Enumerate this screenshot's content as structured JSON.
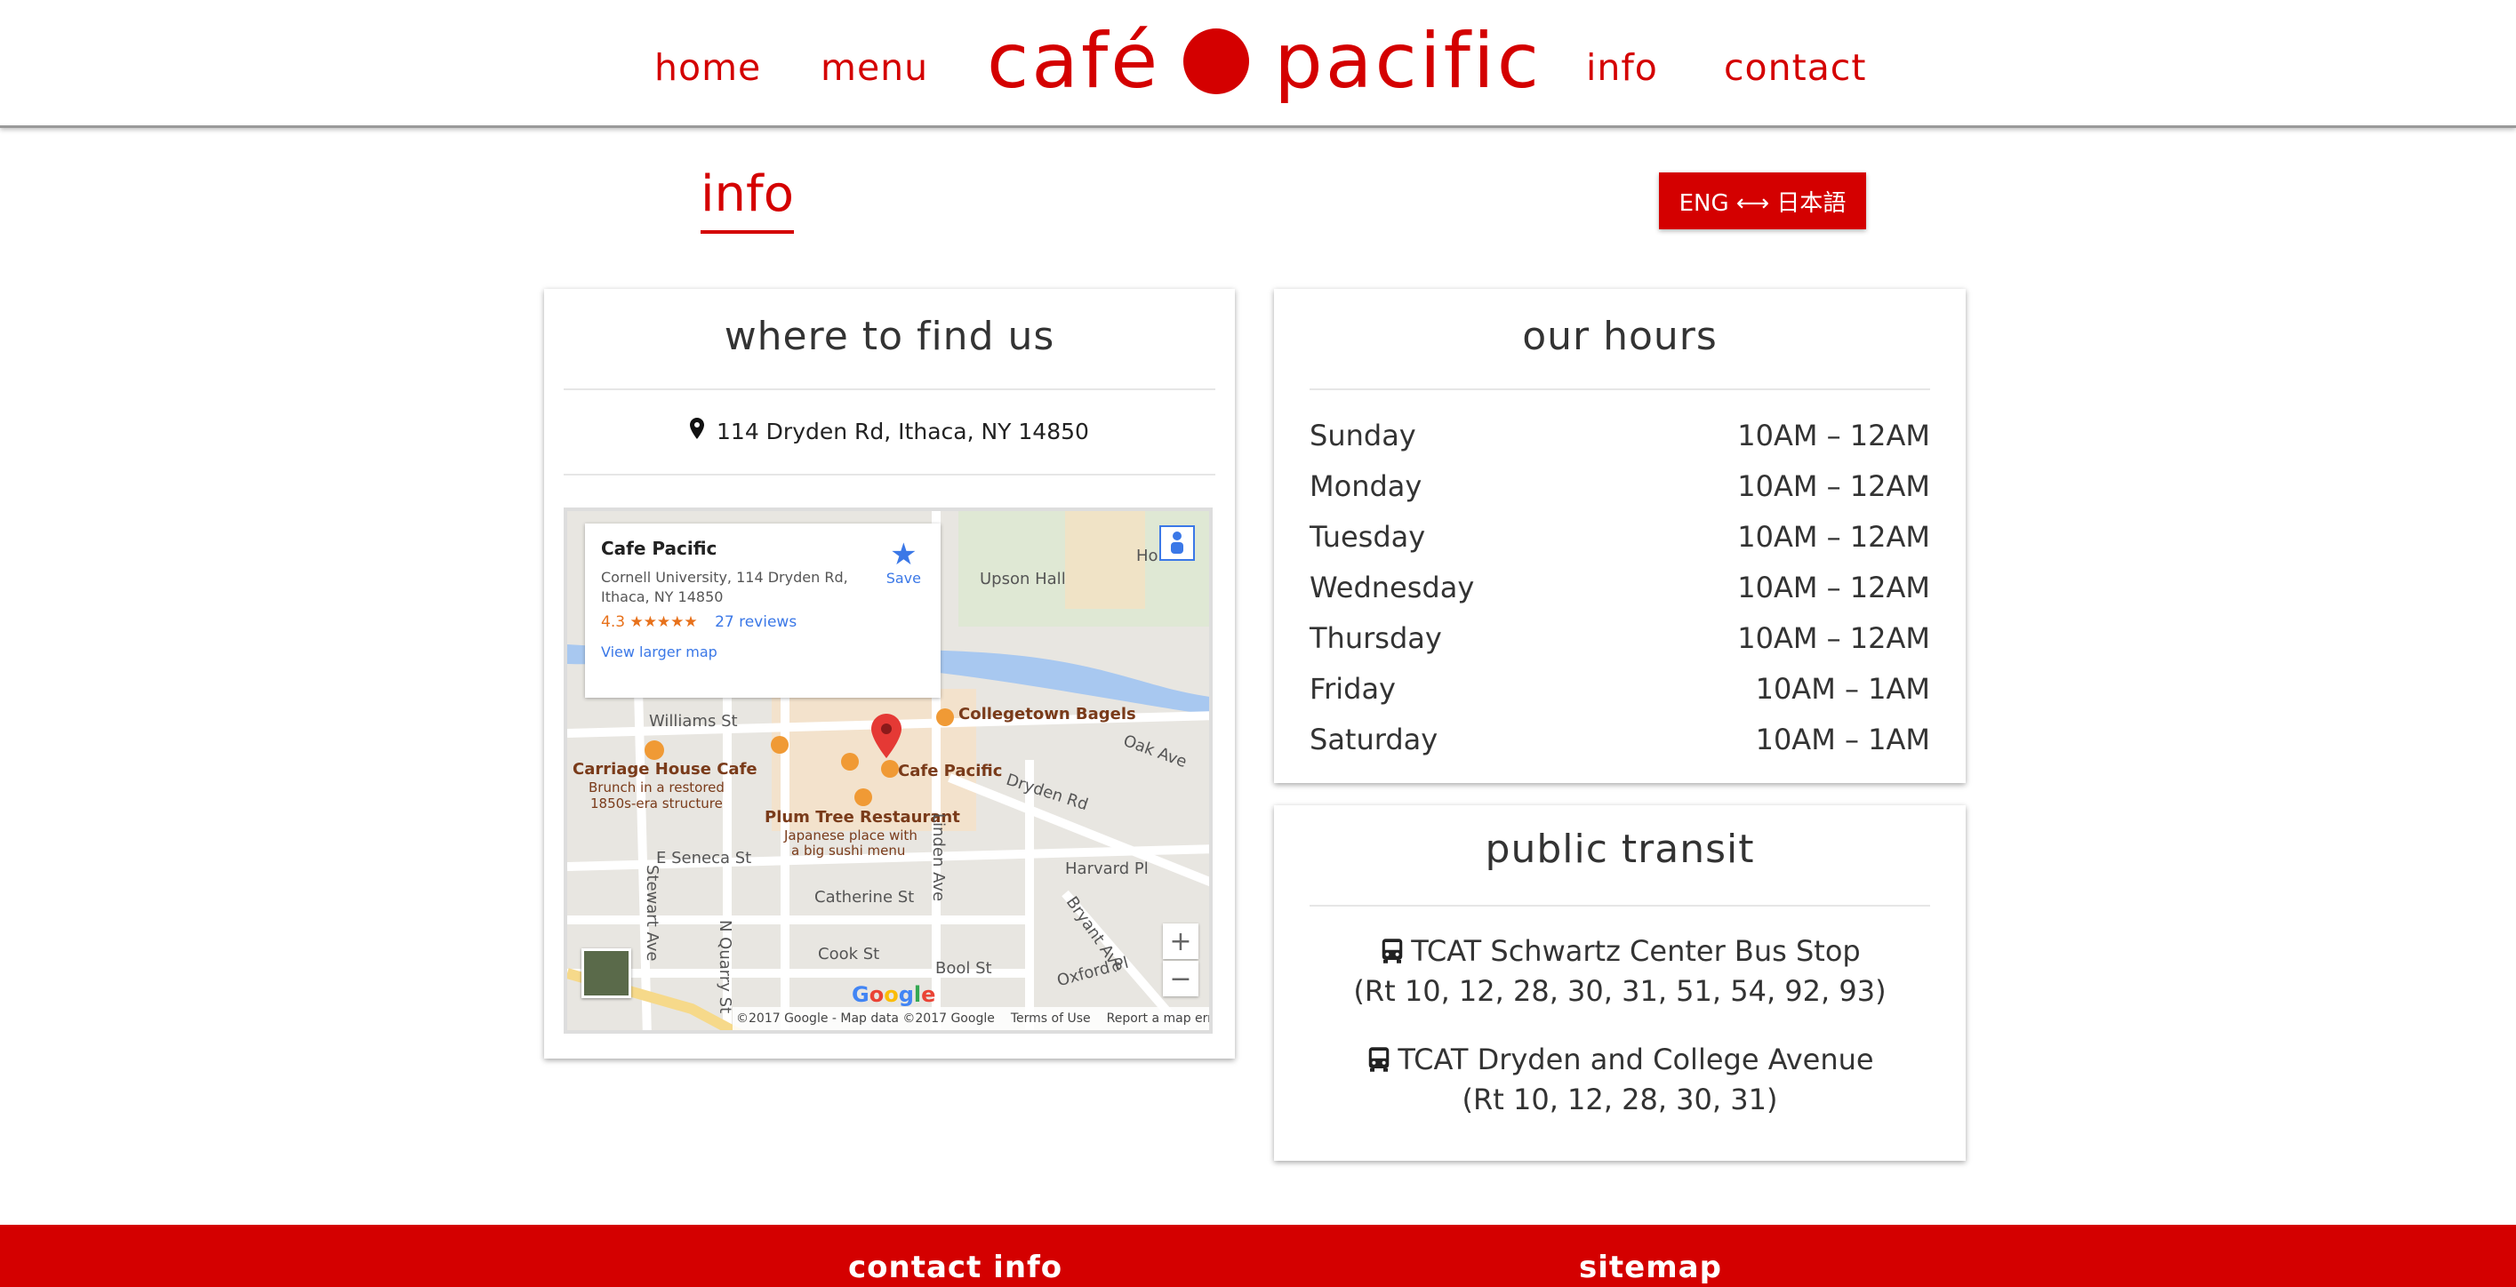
{
  "header": {
    "nav_left": [
      "home",
      "menu"
    ],
    "logo_left": "café",
    "logo_right": "pacific",
    "nav_right": [
      "info",
      "contact"
    ],
    "accent_color": "#d40000"
  },
  "page": {
    "title": "info",
    "language_toggle": "ENG ⟷ 日本語"
  },
  "location": {
    "heading": "where to find us",
    "address": "114 Dryden Rd, Ithaca, NY 14850",
    "address_icon": "map-marker-icon",
    "map": {
      "place_name": "Cafe Pacific",
      "place_address": "Cornell University, 114 Dryden Rd, Ithaca, NY 14850",
      "rating": "4.3",
      "stars": "★★★★★",
      "reviews": "27 reviews",
      "save_label": "Save",
      "larger_map_link": "View larger map",
      "labels": {
        "upson_hall": "Upson Hall",
        "hollister": "Ho",
        "williams_st": "Williams St",
        "collegetown_bagels": "Collegetown Bagels",
        "oak_ave": "Oak Ave",
        "carriage_house": "Carriage House Cafe",
        "carriage_sub1": "Brunch in a restored",
        "carriage_sub2": "1850s-era structure",
        "cafe_pacific": "Cafe Pacific",
        "dryden_rd": "Dryden Rd",
        "plum_tree": "Plum Tree Restaurant",
        "plum_sub1": "Japanese place with",
        "plum_sub2": "a big sushi menu",
        "linden_ave": "Linden Ave",
        "e_seneca": "E Seneca St",
        "harvard_pl": "Harvard Pl",
        "catherine_st": "Catherine St",
        "bryant_ave": "Bryant Ave",
        "stewart_ave": "Stewart Ave",
        "n_quarry": "N Quarry St",
        "cook_st": "Cook St",
        "bool_st": "Bool St",
        "oxford_pl": "Oxford Pl"
      },
      "zoom_in": "+",
      "zoom_out": "−",
      "google": [
        "G",
        "o",
        "o",
        "g",
        "l",
        "e"
      ],
      "copyright": "©2017 Google - Map data ©2017 Google",
      "terms": "Terms of Use",
      "report": "Report a map error"
    }
  },
  "hours": {
    "heading": "our hours",
    "rows": [
      {
        "day": "Sunday",
        "time": "10AM – 12AM"
      },
      {
        "day": "Monday",
        "time": "10AM – 12AM"
      },
      {
        "day": "Tuesday",
        "time": "10AM – 12AM"
      },
      {
        "day": "Wednesday",
        "time": "10AM – 12AM"
      },
      {
        "day": "Thursday",
        "time": "10AM – 12AM"
      },
      {
        "day": "Friday",
        "time": "10AM – 1AM"
      },
      {
        "day": "Saturday",
        "time": "10AM – 1AM"
      }
    ]
  },
  "transit": {
    "heading": "public transit",
    "stops": [
      {
        "name": "TCAT Schwartz Center Bus Stop",
        "routes": "(Rt 10, 12, 28, 30, 31, 51, 54, 92, 93)"
      },
      {
        "name": "TCAT Dryden and College Avenue",
        "routes": "(Rt 10, 12, 28, 30, 31)"
      }
    ]
  },
  "footer": {
    "contact_heading": "contact info",
    "sitemap_heading": "sitemap"
  }
}
